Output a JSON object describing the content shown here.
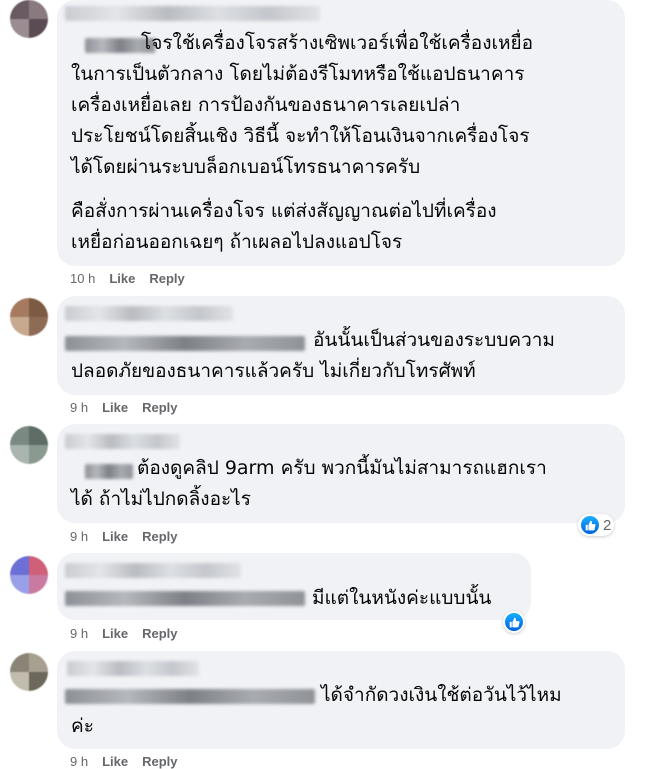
{
  "comments": [
    {
      "paragraph1": [
        "โจรใช้เครื่องโจรสร้างเซิพเวอร์เพื่อใช้เครื่องเหยื่อ",
        "ในการเป็นตัวกลาง โดยไม่ต้องรีโมทหรือใช้แอปธนาคาร",
        "เครื่องเหยื่อเลย การป้องกันของธนาคารเลยเปล่า",
        "ประโยชน์โดยสิ้นเชิง วิธีนี้ จะทำให้โอนเงินจากเครื่องโจร",
        "ได้โดยผ่านระบบล็อกเบอน์โทรธนาคารครับ"
      ],
      "paragraph2": [
        "คือสั่งการผ่านเครื่องโจร แต่ส่งสัญญาณต่อไปที่เครื่อง",
        "เหยื่อก่อนออกเฉยๆ ถ้าเผลอไปลงแอปโจร"
      ],
      "time": "10 h",
      "like": "Like",
      "reply": "Reply"
    },
    {
      "lines": [
        "อันนั้นเป็นส่วนของระบบความ",
        "ปลอดภัยของธนาคารแล้วครับ ไม่เกี่ยวกับโทรศัพท์"
      ],
      "time": "9 h",
      "like": "Like",
      "reply": "Reply"
    },
    {
      "lines": [
        "ต้องดูคลิป 9arm ครับ พวกนี้มันไม่สามารถแฮกเรา",
        "ได้ ถ้าไม่ไปกดลิ้งอะไร"
      ],
      "time": "9 h",
      "like": "Like",
      "reply": "Reply",
      "reaction_count": "2"
    },
    {
      "lines": [
        "มีแต่ในหนังค่ะแบบนั้น"
      ],
      "time": "9 h",
      "like": "Like",
      "reply": "Reply"
    },
    {
      "lines": [
        "ได้จำกัดวงเงินใช้ต่อวันไว้ไหม",
        "ค่ะ"
      ],
      "time": "9 h",
      "like": "Like",
      "reply": "Reply"
    }
  ]
}
